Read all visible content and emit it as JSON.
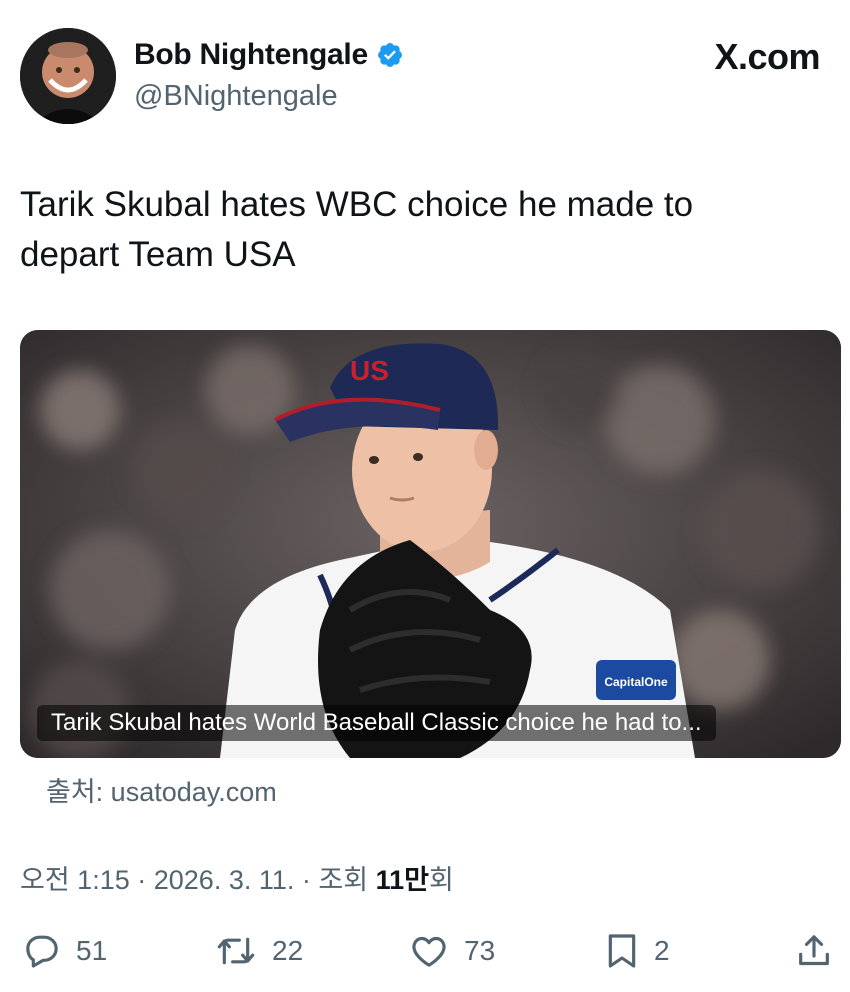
{
  "author": {
    "name": "Bob Nightengale",
    "handle": "@BNightengale",
    "verified": true
  },
  "site_label": "X.com",
  "tweet": {
    "text_line1": "Tarik Skubal hates WBC choice he made to",
    "text_line2": "depart Team USA"
  },
  "media": {
    "caption": "Tarik Skubal hates World Baseball Classic choice he had to..."
  },
  "source": "출처: usatoday.com",
  "meta": {
    "time": "오전 1:15",
    "date": "2026. 3. 11.",
    "views_label": "조회",
    "views_count": "11만",
    "views_suffix": "회"
  },
  "actions": {
    "replies": "51",
    "reposts": "22",
    "likes": "73",
    "bookmarks": "2"
  },
  "colors": {
    "text": "#0f1419",
    "secondary": "#536471",
    "verified": "#1d9bf0"
  }
}
